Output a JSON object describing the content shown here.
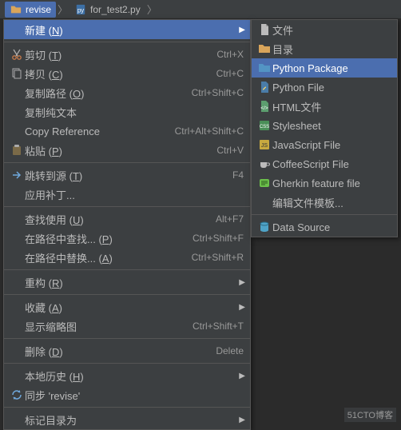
{
  "breadcrumb": {
    "item1": "revise",
    "item2": "for_test2.py"
  },
  "main_menu": [
    {
      "label": "新建 (N)",
      "mnemonic": "N",
      "icon": "",
      "submenu": true,
      "highlight": true
    },
    {
      "sep": true
    },
    {
      "label": "剪切 (T)",
      "mnemonic": "T",
      "icon": "cut",
      "shortcut": "Ctrl+X"
    },
    {
      "label": "拷贝 (C)",
      "mnemonic": "C",
      "icon": "copy",
      "shortcut": "Ctrl+C"
    },
    {
      "label": "复制路径 (O)",
      "mnemonic": "O",
      "icon": "",
      "shortcut": "Ctrl+Shift+C"
    },
    {
      "label": "复制纯文本",
      "icon": ""
    },
    {
      "label": "Copy Reference",
      "icon": "",
      "shortcut": "Ctrl+Alt+Shift+C"
    },
    {
      "label": "粘贴 (P)",
      "mnemonic": "P",
      "icon": "paste",
      "shortcut": "Ctrl+V"
    },
    {
      "sep": true
    },
    {
      "label": "跳转到源 (T)",
      "mnemonic": "T",
      "icon": "goto",
      "shortcut": "F4"
    },
    {
      "label": "应用补丁...",
      "icon": ""
    },
    {
      "sep": true
    },
    {
      "label": "查找使用 (U)",
      "mnemonic": "U",
      "icon": "",
      "shortcut": "Alt+F7"
    },
    {
      "label": "在路径中查找... (P)",
      "mnemonic": "P",
      "icon": "",
      "shortcut": "Ctrl+Shift+F"
    },
    {
      "label": "在路径中替换... (A)",
      "mnemonic": "A",
      "icon": "",
      "shortcut": "Ctrl+Shift+R"
    },
    {
      "sep": true
    },
    {
      "label": "重构 (R)",
      "mnemonic": "R",
      "icon": "",
      "submenu": true
    },
    {
      "sep": true
    },
    {
      "label": "收藏 (A)",
      "mnemonic": "A",
      "icon": "",
      "submenu": true
    },
    {
      "label": "显示缩略图",
      "icon": "",
      "shortcut": "Ctrl+Shift+T"
    },
    {
      "sep": true
    },
    {
      "label": "删除 (D)",
      "mnemonic": "D",
      "icon": "",
      "shortcut": "Delete"
    },
    {
      "sep": true
    },
    {
      "label": "本地历史 (H)",
      "mnemonic": "H",
      "icon": "",
      "submenu": true
    },
    {
      "label": "同步 'revise'",
      "icon": "sync"
    },
    {
      "sep": true
    },
    {
      "label": "标记目录为",
      "icon": "",
      "submenu": true
    }
  ],
  "sub_menu": [
    {
      "label": "文件",
      "icon": "file"
    },
    {
      "label": "目录",
      "icon": "dir"
    },
    {
      "label": "Python Package",
      "icon": "pkg",
      "highlight": true
    },
    {
      "label": "Python File",
      "icon": "py"
    },
    {
      "label": "HTML文件",
      "icon": "html"
    },
    {
      "label": "Stylesheet",
      "icon": "css"
    },
    {
      "label": "JavaScript File",
      "icon": "js"
    },
    {
      "label": "CoffeeScript File",
      "icon": "coffee"
    },
    {
      "label": "Gherkin feature file",
      "icon": "gherkin"
    },
    {
      "label": "编辑文件模板...",
      "icon": ""
    },
    {
      "sep": true
    },
    {
      "label": "Data Source",
      "icon": "db"
    }
  ],
  "watermark": "51CTO博客"
}
